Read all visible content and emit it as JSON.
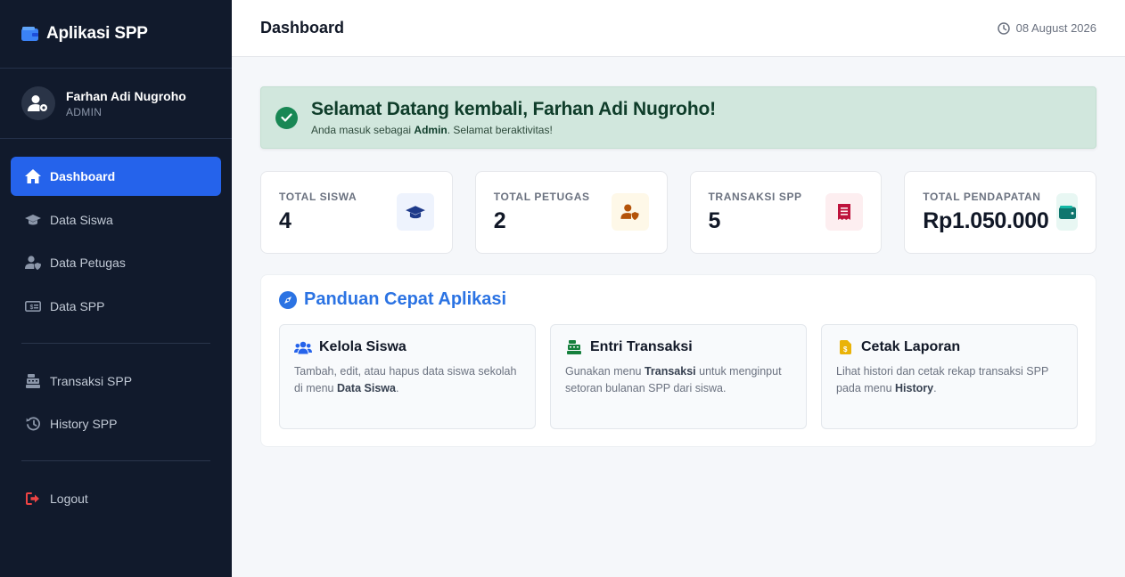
{
  "app": {
    "title": "Aplikasi SPP"
  },
  "user": {
    "name": "Farhan Adi Nugroho",
    "role": "ADMIN"
  },
  "sidebar": {
    "items": [
      {
        "label": "Dashboard",
        "icon": "home-icon",
        "active": true
      },
      {
        "label": "Data Siswa",
        "icon": "graduation-cap-icon"
      },
      {
        "label": "Data Petugas",
        "icon": "user-shield-icon"
      },
      {
        "label": "Data SPP",
        "icon": "money-bill-icon"
      },
      {
        "label": "Transaksi SPP",
        "icon": "cash-register-icon"
      },
      {
        "label": "History SPP",
        "icon": "history-icon"
      }
    ],
    "logout_label": "Logout"
  },
  "header": {
    "title": "Dashboard",
    "date": "08 August 2026"
  },
  "welcome": {
    "title": "Selamat Datang kembali, Farhan Adi Nugroho!",
    "text_prefix": "Anda masuk sebagai ",
    "text_role": "Admin",
    "text_suffix": ". Selamat beraktivitas!"
  },
  "stats": [
    {
      "label": "TOTAL SISWA",
      "value": "4",
      "icon": "graduation-cap-icon",
      "color": "#1e3a8a",
      "bg": "#eef3fd"
    },
    {
      "label": "TOTAL PETUGAS",
      "value": "2",
      "icon": "user-shield-icon",
      "color": "#b45309",
      "bg": "#fef8e8"
    },
    {
      "label": "TRANSAKSI SPP",
      "value": "5",
      "icon": "receipt-icon",
      "color": "#be123c",
      "bg": "#fdeef0"
    },
    {
      "label": "TOTAL PENDAPATAN",
      "value": "Rp1.050.000",
      "icon": "wallet-icon",
      "color": "#0f766e",
      "bg": "#e8f7f3"
    }
  ],
  "guide": {
    "title": "Panduan Cepat Aplikasi",
    "cards": [
      {
        "title": "Kelola Siswa",
        "icon": "users-icon",
        "t1": "Tambah, edit, atau hapus data siswa sekolah di menu ",
        "b1": "Data Siswa",
        "t2": "."
      },
      {
        "title": "Entri Transaksi",
        "icon": "cash-register-icon",
        "t1": "Gunakan menu ",
        "b1": "Transaksi",
        "t2": " untuk menginput setoran bulanan SPP dari siswa."
      },
      {
        "title": "Cetak Laporan",
        "icon": "file-invoice-icon",
        "t1": "Lihat histori dan cetak rekap transaksi SPP pada menu ",
        "b1": "History",
        "t2": "."
      }
    ]
  },
  "colors": {
    "sidebar": "#111a2c",
    "accent": "#2563eb",
    "success": "#198754",
    "guide_title": "#2b73e3"
  }
}
